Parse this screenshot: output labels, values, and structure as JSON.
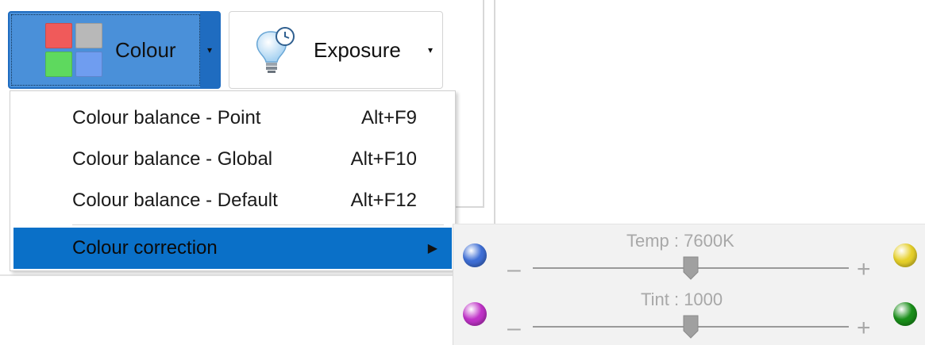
{
  "toolbar": {
    "colour_button": {
      "label": "Colour",
      "swatch_colors": [
        "#f05a5a",
        "#b8b8b8",
        "#5ed95e",
        "#6f9df0"
      ],
      "icon": "colour-grid-icon",
      "arrow": "▾"
    },
    "exposure_button": {
      "label": "Exposure",
      "icon": "lightbulb-clock-icon",
      "arrow": "▾"
    }
  },
  "menu": {
    "items": [
      {
        "label": "Colour balance - Point",
        "shortcut": "Alt+F9"
      },
      {
        "label": "Colour balance - Global",
        "shortcut": "Alt+F10"
      },
      {
        "label": "Colour balance - Default",
        "shortcut": "Alt+F12"
      }
    ],
    "active_item": {
      "label": "Colour correction",
      "arrow": "▶"
    }
  },
  "submenu": {
    "temp": {
      "title": "Temp : 7600K",
      "minus": "–",
      "plus": "+",
      "level": 0.5,
      "left_color": "#3f6fd6",
      "right_color": "#e6d02a"
    },
    "tint": {
      "title": "Tint : 1000",
      "minus": "–",
      "plus": "+",
      "level": 0.5,
      "left_color": "#c033c8",
      "right_color": "#1a8f1a"
    }
  },
  "colors": {
    "accent": "#0a70c8",
    "button_active": "#4a90d9"
  }
}
